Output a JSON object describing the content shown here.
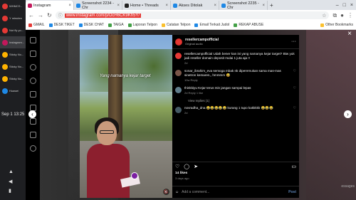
{
  "dock": {
    "items": [
      {
        "label": "WHMCS -",
        "color": "#e53935"
      },
      {
        "label": "Y minutes",
        "color": "#e53935"
      },
      {
        "label": "Not fly yo...",
        "color": "#e53935"
      },
      {
        "label": "Instagram...",
        "color": "#c2185b"
      },
      {
        "label": "Sticky No...",
        "color": "#ffb300"
      },
      {
        "label": "Sticky No...",
        "color": "#ffb300"
      },
      {
        "label": "Sticky No...",
        "color": "#ffb300"
      },
      {
        "label": "Huawei",
        "color": "#1e88e5"
      }
    ],
    "clock": "Sep 1 13:25"
  },
  "browser": {
    "tabs": [
      {
        "label": "Instagram",
        "color": "#c2185b",
        "active": true
      },
      {
        "label": "Screenshot 2234 - Chr",
        "color": "#1e88e5",
        "active": false
      },
      {
        "label": "Home • Threads",
        "color": "#222222",
        "active": false
      },
      {
        "label": "Akses Ditolak",
        "color": "#1e88e5",
        "active": false
      },
      {
        "label": "Screenshot 2235 - Chr",
        "color": "#1e88e5",
        "active": false
      }
    ],
    "url": "www.instagram.com/p/DcH6CK9Kh5Y/",
    "bookmarks": [
      {
        "label": "GMAIL",
        "color": "#e53935"
      },
      {
        "label": "DESK TIKET",
        "color": "#1e88e5"
      },
      {
        "label": "DESK CHAT",
        "color": "#1e88e5"
      },
      {
        "label": "TAIGA",
        "color": "#43a047"
      },
      {
        "label": "Laporan Telpon",
        "color": "#43a047"
      },
      {
        "label": "Catatan Telpon",
        "color": "#fbc02d"
      },
      {
        "label": "Email Terkait Judol",
        "color": "#1e88e5"
      },
      {
        "label": "REKAP ABUSE",
        "color": "#43a047"
      }
    ],
    "other_bookmarks": "Other Bookmarks"
  },
  "video": {
    "caption": "Yang namanya kejar target"
  },
  "post": {
    "username": "resellercampofficial",
    "subtitle": "Original audio",
    "comments": [
      {
        "text": "resellercampofficial Udah bener kan ini yang namanya kejar target? Btw yuk jadi reseller domain deposit mulai 1 juta aja !!",
        "meta": "2d",
        "avatar_color": "#e53935"
      },
      {
        "text": "sonar_ibrahim_eva semoga mbak nk diperemukan sama mas-mas sinetron kemaren,, hmmmm 😅",
        "meta": "10w  Reply",
        "avatar_color": "#795548"
      },
      {
        "text": "thinkkiyu Kejar terus min jangan sampai lepas",
        "meta": "2d  Reply  1 like",
        "avatar_color": "#607d8b"
      },
      {
        "text": "novradha_dna 😂😂😂😂😂 kurang 1 tupo kakkkkk 😂😂😂",
        "meta": "2d",
        "avatar_color": "#455a64"
      }
    ],
    "view_replies": "View replies (1)",
    "likes": "14 likes",
    "ago": "3 days ago",
    "add_comment_placeholder": "Add a comment...",
    "post_label": "Post"
  },
  "background_text": "essages"
}
